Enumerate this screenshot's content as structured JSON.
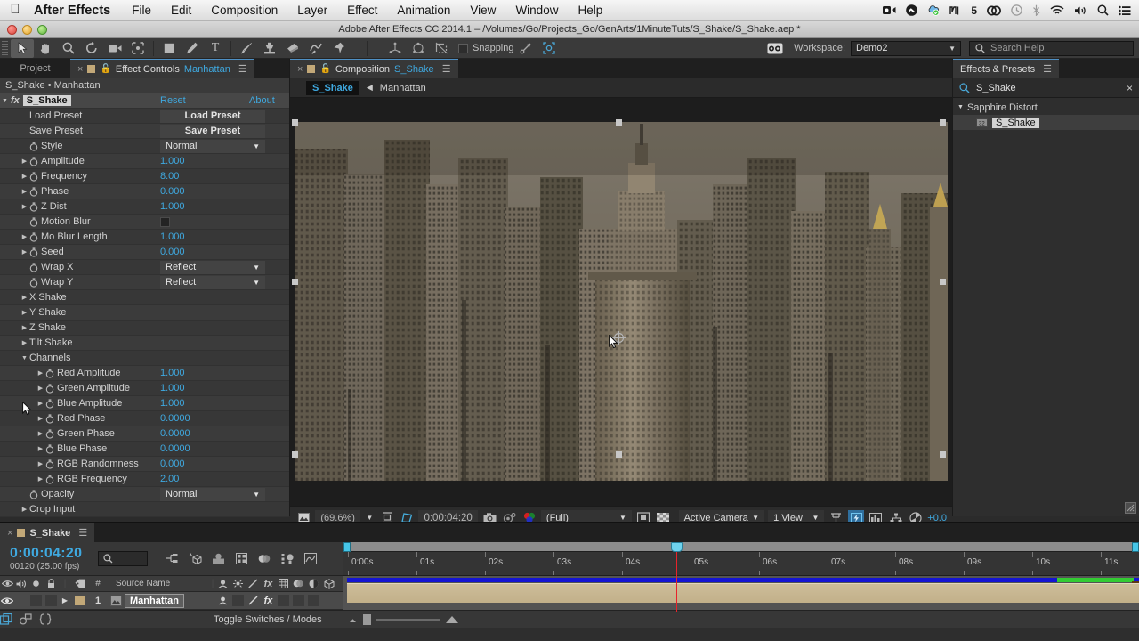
{
  "macmenu": {
    "apple_icon": "apple-icon",
    "app_name": "After Effects",
    "items": [
      "File",
      "Edit",
      "Composition",
      "Layer",
      "Effect",
      "Animation",
      "View",
      "Window",
      "Help"
    ],
    "status_icons": [
      "screen-record-icon",
      "dropbox-icon",
      "sync-icon",
      "alfred-icon",
      "creative-cloud-icon",
      "time-machine-icon",
      "bluetooth-icon",
      "wifi-icon",
      "volume-icon",
      "spotlight-search-icon",
      "notification-center-icon"
    ],
    "alfred_badge": "5"
  },
  "window": {
    "title": "Adobe After Effects CC 2014.1 – /Volumes/Go/Projects_Go/GenArts/1MinuteTuts/S_Shake/S_Shake.aep *"
  },
  "toolbar": {
    "tools": [
      "selection-tool",
      "hand-tool",
      "zoom-tool",
      "rotation-tool",
      "camera-tool",
      "pan-behind-tool",
      "shape-tool",
      "pen-tool",
      "text-tool",
      "brush-tool",
      "clone-stamp-tool",
      "eraser-tool",
      "roto-brush-tool",
      "puppet-pin-tool"
    ],
    "rig_tools": [
      "local-axis-mode",
      "world-axis-mode",
      "view-axis-mode"
    ],
    "snapping_label": "Snapping",
    "snapping_checked": false,
    "workspace_label": "Workspace:",
    "workspace_value": "Demo2",
    "search_help_placeholder": "Search Help"
  },
  "effect_controls": {
    "tabs": [
      {
        "label": "Project",
        "active": false
      },
      {
        "label": "Effect Controls",
        "suffix": "Manhattan",
        "active": true
      }
    ],
    "breadcrumb": "S_Shake • Manhattan",
    "effect_name": "S_Shake",
    "reset_label": "Reset",
    "about_label": "About",
    "properties": [
      {
        "name": "Load Preset",
        "type": "button",
        "value": "Load Preset",
        "indent": 1
      },
      {
        "name": "Save Preset",
        "type": "button",
        "value": "Save Preset",
        "indent": 1
      },
      {
        "name": "Style",
        "type": "dropdown",
        "value": "Normal",
        "indent": 1,
        "stopwatch": true
      },
      {
        "name": "Amplitude",
        "type": "number",
        "value": "1.000",
        "indent": 1,
        "stopwatch": true,
        "expandable": true
      },
      {
        "name": "Frequency",
        "type": "number",
        "value": "8.00",
        "indent": 1,
        "stopwatch": true,
        "expandable": true
      },
      {
        "name": "Phase",
        "type": "number",
        "value": "0.000",
        "indent": 1,
        "stopwatch": true,
        "expandable": true
      },
      {
        "name": "Z Dist",
        "type": "number",
        "value": "1.000",
        "indent": 1,
        "stopwatch": true,
        "expandable": true
      },
      {
        "name": "Motion Blur",
        "type": "checkbox",
        "value": "",
        "indent": 1,
        "stopwatch": true
      },
      {
        "name": "Mo Blur Length",
        "type": "number",
        "value": "1.000",
        "indent": 1,
        "stopwatch": true,
        "expandable": true
      },
      {
        "name": "Seed",
        "type": "number",
        "value": "0.000",
        "indent": 1,
        "stopwatch": true,
        "expandable": true
      },
      {
        "name": "Wrap X",
        "type": "dropdown",
        "value": "Reflect",
        "indent": 1,
        "stopwatch": true
      },
      {
        "name": "Wrap Y",
        "type": "dropdown",
        "value": "Reflect",
        "indent": 1,
        "stopwatch": true
      },
      {
        "name": "X Shake",
        "type": "group",
        "value": "",
        "indent": 0,
        "expandable": true
      },
      {
        "name": "Y Shake",
        "type": "group",
        "value": "",
        "indent": 0,
        "expandable": true
      },
      {
        "name": "Z Shake",
        "type": "group",
        "value": "",
        "indent": 0,
        "expandable": true
      },
      {
        "name": "Tilt Shake",
        "type": "group",
        "value": "",
        "indent": 0,
        "expandable": true
      },
      {
        "name": "Channels",
        "type": "group-open",
        "value": "",
        "indent": 0,
        "expandable": true
      },
      {
        "name": "Red Amplitude",
        "type": "number",
        "value": "1.000",
        "indent": 2,
        "stopwatch": true,
        "expandable": true
      },
      {
        "name": "Green Amplitude",
        "type": "number",
        "value": "1.000",
        "indent": 2,
        "stopwatch": true,
        "expandable": true
      },
      {
        "name": "Blue Amplitude",
        "type": "number",
        "value": "1.000",
        "indent": 2,
        "stopwatch": true,
        "expandable": true
      },
      {
        "name": "Red Phase",
        "type": "number",
        "value": "0.0000",
        "indent": 2,
        "stopwatch": true,
        "expandable": true
      },
      {
        "name": "Green Phase",
        "type": "number",
        "value": "0.0000",
        "indent": 2,
        "stopwatch": true,
        "expandable": true
      },
      {
        "name": "Blue Phase",
        "type": "number",
        "value": "0.0000",
        "indent": 2,
        "stopwatch": true,
        "expandable": true
      },
      {
        "name": "RGB Randomness",
        "type": "number",
        "value": "0.000",
        "indent": 2,
        "stopwatch": true,
        "expandable": true
      },
      {
        "name": "RGB Frequency",
        "type": "number",
        "value": "2.00",
        "indent": 2,
        "stopwatch": true,
        "expandable": true
      },
      {
        "name": "Opacity",
        "type": "dropdown",
        "value": "Normal",
        "indent": 1,
        "stopwatch": true
      },
      {
        "name": "Crop Input",
        "type": "group",
        "value": "",
        "indent": 0,
        "expandable": true
      }
    ]
  },
  "composition": {
    "tab_label": "Composition",
    "tab_suffix": "S_Shake",
    "breadcrumb_active": "S_Shake",
    "breadcrumb_item": "Manhattan",
    "footer": {
      "magnification": "(69.6%)",
      "timecode": "0:00:04:20",
      "resolution": "(Full)",
      "view_camera": "Active Camera",
      "view_layout": "1 View",
      "exposure": "+0.0",
      "icons": [
        "always-preview-icon",
        "region-of-interest-icon",
        "transparency-grid-icon",
        "mask-path-icon",
        "snapshot-icon",
        "show-snapshot-icon",
        "channel-icon",
        "toggle-pixel-aspect-icon",
        "fast-previews-icon",
        "timeline-icon",
        "comp-flowchart-icon",
        "exposure-icon"
      ]
    }
  },
  "effects_presets": {
    "tab_label": "Effects & Presets",
    "search_value": "S_Shake",
    "group": "Sapphire Distort",
    "items": [
      {
        "label": "S_Shake",
        "selected": true
      }
    ]
  },
  "timeline": {
    "tab_label": "S_Shake",
    "current_time": "0:00:04:20",
    "frame_info": "00120 (25.00 fps)",
    "search_placeholder": "",
    "tool_icons": [
      "composition-mini-flowchart-icon",
      "draft-3d-icon",
      "hide-shy-layers-icon",
      "frame-blending-icon",
      "motion-blur-icon",
      "graph-editor-icon",
      "brainstorm-icon",
      "auto-keyframe-icon"
    ],
    "ruler_labels": [
      "0:00s",
      "01s",
      "02s",
      "03s",
      "04s",
      "05s",
      "06s",
      "07s",
      "08s",
      "09s",
      "10s",
      "11s"
    ],
    "columns": [
      "Source Name"
    ],
    "column_icons": [
      "video-eye-icon",
      "audio-icon",
      "solo-icon",
      "lock-icon",
      "label-icon",
      "index-icon",
      "shy-icon",
      "collapse-transform-icon",
      "quality-icon",
      "effects-fx-icon",
      "frame-blend-icon",
      "motion-blur-icon",
      "adjustment-layer-icon",
      "3d-layer-icon"
    ],
    "layers": [
      {
        "index": "1",
        "name": "Manhattan",
        "visible": true,
        "has_fx": true
      }
    ],
    "footer": {
      "toggle_label": "Toggle Switches / Modes",
      "icons": [
        "frame-render-time-icon",
        "comp-flowchart-icon",
        "expression-icon"
      ]
    }
  },
  "colors": {
    "accent_blue": "#3fa9e0",
    "playhead_red": "#e8232b",
    "layer_bar": "#c6b490",
    "work_area_green": "#33cc33",
    "timeline_blue": "#1414d2"
  }
}
